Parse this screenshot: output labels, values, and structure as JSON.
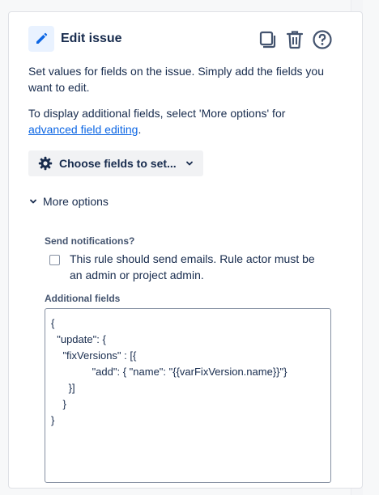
{
  "colors": {
    "accent": "#0c66e4",
    "icon_bg": "#e9f2ff",
    "text": "#172b4d",
    "subtle": "#44546f"
  },
  "header": {
    "icon": "pencil-icon",
    "title": "Edit issue",
    "actions": [
      {
        "name": "duplicate-button",
        "icon": "duplicate-icon"
      },
      {
        "name": "delete-button",
        "icon": "trash-icon"
      },
      {
        "name": "help-button",
        "icon": "help-icon"
      }
    ]
  },
  "description": "Set values for fields on the issue. Simply add the fields you want to edit.",
  "more_info": {
    "prefix": "To display additional fields, select 'More options' for ",
    "link": "advanced field editing",
    "suffix": "."
  },
  "choose_fields": {
    "icon": "gear-icon",
    "label": "Choose fields to set...",
    "chevron": "chevron-down-icon"
  },
  "more_options": {
    "icon": "chevron-down-icon",
    "label": "More options"
  },
  "notifications": {
    "label": "Send notifications?",
    "checkbox_label": "This rule should send emails. Rule actor must be an admin or project admin.",
    "checked": false
  },
  "additional_fields": {
    "label": "Additional fields",
    "value": "{\n  \"update\": {\n    \"fixVersions\" : [{\n              \"add\": { \"name\": \"{{varFixVersion.name}}\"}\n      }]\n    }\n}"
  }
}
